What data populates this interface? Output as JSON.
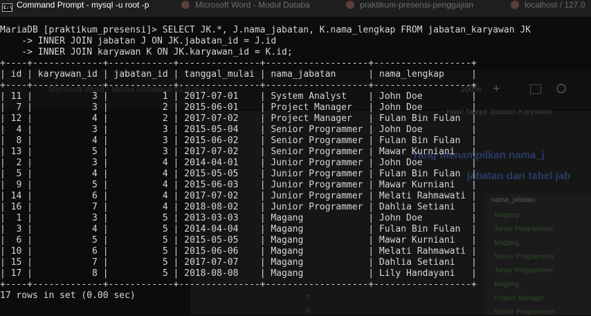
{
  "window": {
    "title": "Command Prompt - mysql  -u root -p",
    "icon_text": "C:\\",
    "background_tabs": [
      "Microsoft Word - Modul Databa",
      "praktikum-presensi-penggajian",
      "localhost / 127.0"
    ]
  },
  "background": {
    "toolbar_items": [
      "Microsoft Word - Modul Database v1.0.docx",
      "100%",
      "+"
    ],
    "caption": "Hasil Tampil Jabatan Karyawan",
    "para_line1": "Yang menampilkan nama_j",
    "para_line2": "jabatan dari tabel jab",
    "table_header": "nama_jabatan",
    "table_values": [
      "Magang",
      "Junior Programmer",
      "Magang",
      "Senior Programmer",
      "Junior Programmer",
      "Magang",
      "Project Manager",
      "Senior Programmer"
    ],
    "row_numbers": [
      "7",
      "8"
    ]
  },
  "console": {
    "prompt": "MariaDB [praktikum_presensi]>",
    "query_lines": [
      "MariaDB [praktikum_presensi]> SELECT JK.*, J.nama_jabatan, K.nama_lengkap FROM jabatan_karyawan JK",
      "    -> INNER JOIN jabatan J ON JK.jabatan_id = J.id",
      "    -> INNER JOIN karyawan K ON JK.karyawan_id = K.id;"
    ],
    "columns": [
      "id",
      "karyawan_id",
      "jabatan_id",
      "tanggal_mulai",
      "nama_jabatan",
      "nama_lengkap"
    ],
    "col_widths": [
      4,
      13,
      12,
      15,
      19,
      18
    ],
    "col_align": [
      "right",
      "right",
      "right",
      "left",
      "left",
      "left"
    ],
    "rows": [
      [
        "11",
        "3",
        "1",
        "2017-07-01",
        "System Analyst",
        "John Doe"
      ],
      [
        "7",
        "3",
        "2",
        "2015-06-01",
        "Project Manager",
        "John Doe"
      ],
      [
        "12",
        "4",
        "2",
        "2017-07-02",
        "Project Manager",
        "Fulan Bin Fulan"
      ],
      [
        "4",
        "3",
        "3",
        "2015-05-04",
        "Senior Programmer",
        "John Doe"
      ],
      [
        "8",
        "4",
        "3",
        "2015-06-02",
        "Senior Programmer",
        "Fulan Bin Fulan"
      ],
      [
        "13",
        "5",
        "3",
        "2017-07-02",
        "Senior Programmer",
        "Mawar Kurniani"
      ],
      [
        "2",
        "3",
        "4",
        "2014-04-01",
        "Junior Programmer",
        "John Doe"
      ],
      [
        "5",
        "4",
        "4",
        "2015-05-05",
        "Junior Programmer",
        "Fulan Bin Fulan"
      ],
      [
        "9",
        "5",
        "4",
        "2015-06-03",
        "Junior Programmer",
        "Mawar Kurniani"
      ],
      [
        "14",
        "6",
        "4",
        "2017-07-02",
        "Junior Programmer",
        "Melati Rahmawati"
      ],
      [
        "16",
        "7",
        "4",
        "2018-08-02",
        "Junior Programmer",
        "Dahlia Setiani"
      ],
      [
        "1",
        "3",
        "5",
        "2013-03-03",
        "Magang",
        "John Doe"
      ],
      [
        "3",
        "4",
        "5",
        "2014-04-04",
        "Magang",
        "Fulan Bin Fulan"
      ],
      [
        "6",
        "5",
        "5",
        "2015-05-05",
        "Magang",
        "Mawar Kurniani"
      ],
      [
        "10",
        "6",
        "5",
        "2015-06-06",
        "Magang",
        "Melati Rahmawati"
      ],
      [
        "15",
        "7",
        "5",
        "2017-07-07",
        "Magang",
        "Dahlia Setiani"
      ],
      [
        "17",
        "8",
        "5",
        "2018-08-08",
        "Magang",
        "Lily Handayani"
      ]
    ],
    "footer": "17 rows in set (0.00 sec)"
  },
  "colors": {
    "console_bg": "#0c0c0c",
    "console_text": "#d8d8d8",
    "titlebar_bg": "#1e1e1e"
  }
}
